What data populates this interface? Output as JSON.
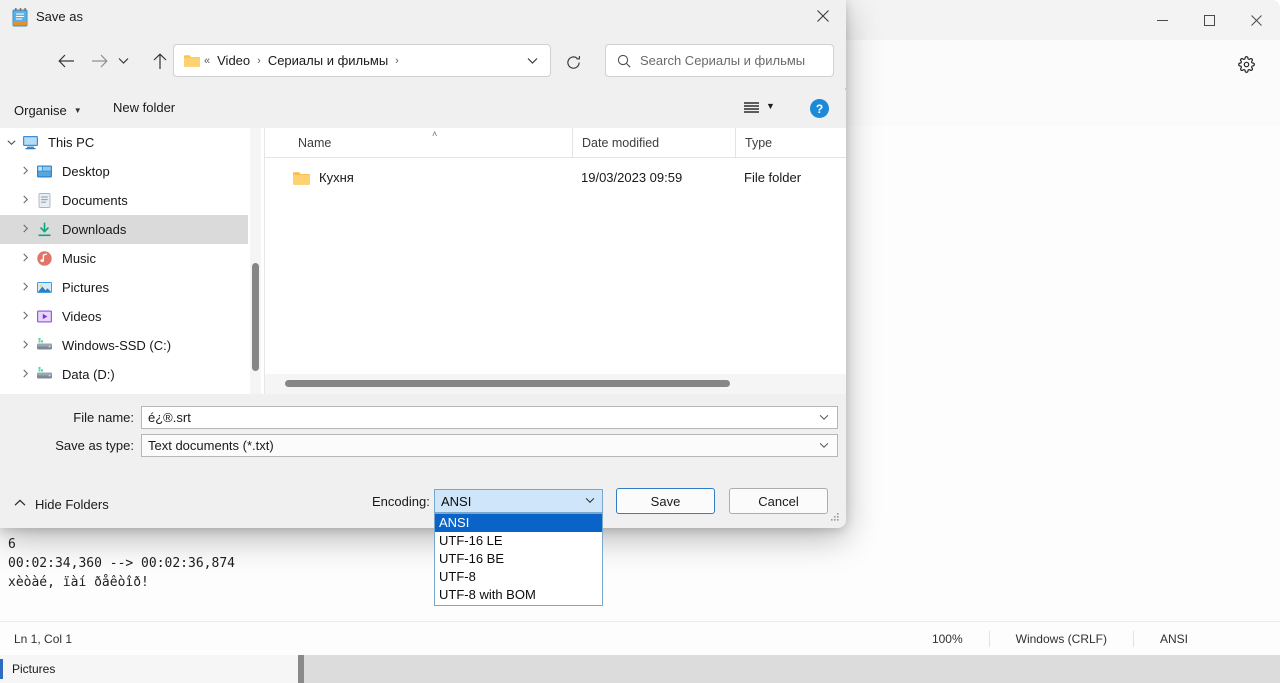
{
  "notepad": {
    "window_controls": {
      "minimize": "minimize-icon",
      "maximize": "maximize-icon",
      "close": "close-icon"
    },
    "settings_icon": "gear-icon",
    "editor_text": "6\n00:02:34,360 --> 00:02:36,874\nxèòàé, ïàí ðåêòîð!",
    "status": {
      "cursor": "Ln 1, Col 1",
      "zoom": "100%",
      "line_ending": "Windows (CRLF)",
      "encoding": "ANSI"
    }
  },
  "taskbar": {
    "item_label": "Pictures"
  },
  "dialog": {
    "title": "Save as",
    "title_icon": "notepad-icon",
    "close_label": "✕",
    "nav": {
      "back": "back-arrow-icon",
      "forward": "forward-arrow-icon",
      "recent": "chevron-down-icon",
      "up": "up-arrow-icon",
      "address_prefix": "«",
      "crumbs": [
        "Video",
        "Сериалы и фильмы"
      ],
      "crumb_separator": "›",
      "address_dropdown": "chevron-down-icon",
      "refresh": "refresh-icon",
      "search_placeholder": "Search Сериалы и фильмы"
    },
    "commandbar": {
      "organise": "Organise",
      "new_folder": "New folder",
      "view_icon": "list-view-icon",
      "view_caret": "chevron-down-icon",
      "help": "?"
    },
    "tree": [
      {
        "label": "This PC",
        "depth": 0,
        "expanded": true,
        "icon": "pc-icon",
        "selected": false
      },
      {
        "label": "Desktop",
        "depth": 1,
        "expanded": false,
        "icon": "desktop-icon",
        "selected": false
      },
      {
        "label": "Documents",
        "depth": 1,
        "expanded": false,
        "icon": "documents-icon",
        "selected": false
      },
      {
        "label": "Downloads",
        "depth": 1,
        "expanded": false,
        "icon": "downloads-icon",
        "selected": true
      },
      {
        "label": "Music",
        "depth": 1,
        "expanded": false,
        "icon": "music-icon",
        "selected": false
      },
      {
        "label": "Pictures",
        "depth": 1,
        "expanded": false,
        "icon": "pictures-icon",
        "selected": false
      },
      {
        "label": "Videos",
        "depth": 1,
        "expanded": false,
        "icon": "videos-icon",
        "selected": false
      },
      {
        "label": "Windows-SSD (C:)",
        "depth": 1,
        "expanded": false,
        "icon": "drive-icon",
        "selected": false
      },
      {
        "label": "Data (D:)",
        "depth": 1,
        "expanded": false,
        "icon": "drive-icon",
        "selected": false
      }
    ],
    "list": {
      "columns": [
        "Name",
        "Date modified",
        "Type"
      ],
      "sort_indicator": "˄",
      "rows": [
        {
          "name": "Кухня",
          "date": "19/03/2023 09:59",
          "type": "File folder",
          "icon": "folder-icon"
        }
      ]
    },
    "fields": {
      "file_name_label": "File name:",
      "file_name_value": "é¿®.srt",
      "save_type_label": "Save as type:",
      "save_type_value": "Text documents (*.txt)"
    },
    "footer": {
      "hide_folders": "Hide Folders",
      "hide_folders_chevron": "chevron-up-icon",
      "encoding_label": "Encoding:",
      "encoding_value": "ANSI",
      "encoding_options": [
        "ANSI",
        "UTF-16 LE",
        "UTF-16 BE",
        "UTF-8",
        "UTF-8 with BOM"
      ],
      "encoding_selected_index": 0,
      "save": "Save",
      "cancel": "Cancel"
    }
  }
}
